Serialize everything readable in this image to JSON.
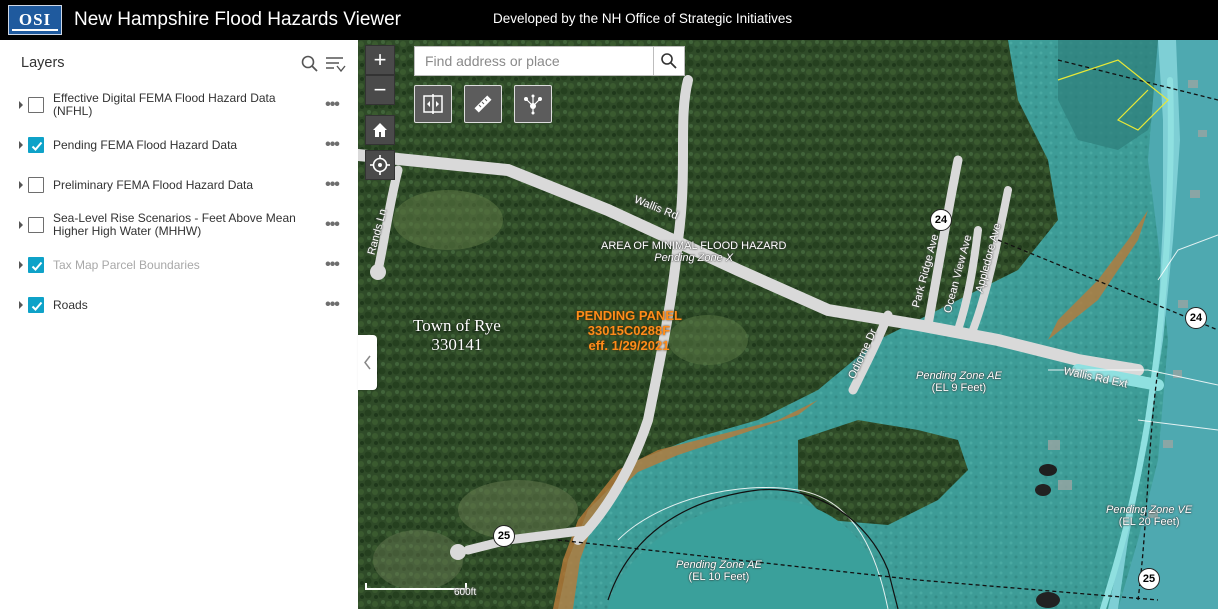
{
  "header": {
    "logo_text": "OSI",
    "title": "New Hampshire Flood Hazards Viewer",
    "credit": "Developed by the NH Office of Strategic Initiatives"
  },
  "sidebar": {
    "title": "Layers",
    "search_icon": "search-icon",
    "filter_icon": "filter-list-icon",
    "layers": [
      {
        "label": "Effective Digital FEMA Flood Hazard Data (NFHL)",
        "checked": false,
        "dimmed": false
      },
      {
        "label": "Pending FEMA Flood Hazard Data",
        "checked": true,
        "dimmed": false
      },
      {
        "label": "Preliminary FEMA Flood Hazard Data",
        "checked": false,
        "dimmed": false
      },
      {
        "label": "Sea-Level Rise Scenarios - Feet Above Mean Higher High Water (MHHW)",
        "checked": false,
        "dimmed": false
      },
      {
        "label": "Tax Map Parcel Boundaries",
        "checked": true,
        "dimmed": true
      },
      {
        "label": "Roads",
        "checked": true,
        "dimmed": false
      }
    ],
    "more_label": "•••"
  },
  "map": {
    "search_placeholder": "Find address or place",
    "zoom_in": "+",
    "zoom_out": "−",
    "labels": {
      "town_name": "Town of Rye",
      "town_code": "330141",
      "panel_title": "PENDING PANEL",
      "panel_number": "33015C0288F",
      "panel_date": "eff. 1/29/2021",
      "minimal_hazard": "AREA OF MINIMAL FLOOD HAZARD",
      "zone_x": "Pending Zone X",
      "zone_ae_9": "Pending Zone AE",
      "zone_ae_9_el": "(EL 9 Feet)",
      "zone_ae_10": "Pending Zone AE",
      "zone_ae_10_el": "(EL 10 Feet)",
      "zone_ve_20": "Pending Zone VE",
      "zone_ve_20_el": "(EL 20 Feet)",
      "scale": "600ft"
    },
    "roads": {
      "wallis_rd": "Wallis Rd",
      "rands_ln": "Rands Ln",
      "odiorne_dr": "Odiorne Dr",
      "park_ridge_ave": "Park Ridge Ave",
      "ocean_view_ave": "Ocean View Ave",
      "appledore_ave": "Appledore Ave",
      "wallis_rd_ext": "Wallis Rd Ext"
    },
    "shields": {
      "route_24_a": "24",
      "route_24_b": "24",
      "route_25_a": "25",
      "route_25_b": "25"
    },
    "colors": {
      "flood_zone": "#3fa7a3",
      "forest": "#2e4a27",
      "road": "#d9d9d9",
      "panel_label": "#ff8c1a",
      "checkbox": "#0ea2c8"
    }
  }
}
